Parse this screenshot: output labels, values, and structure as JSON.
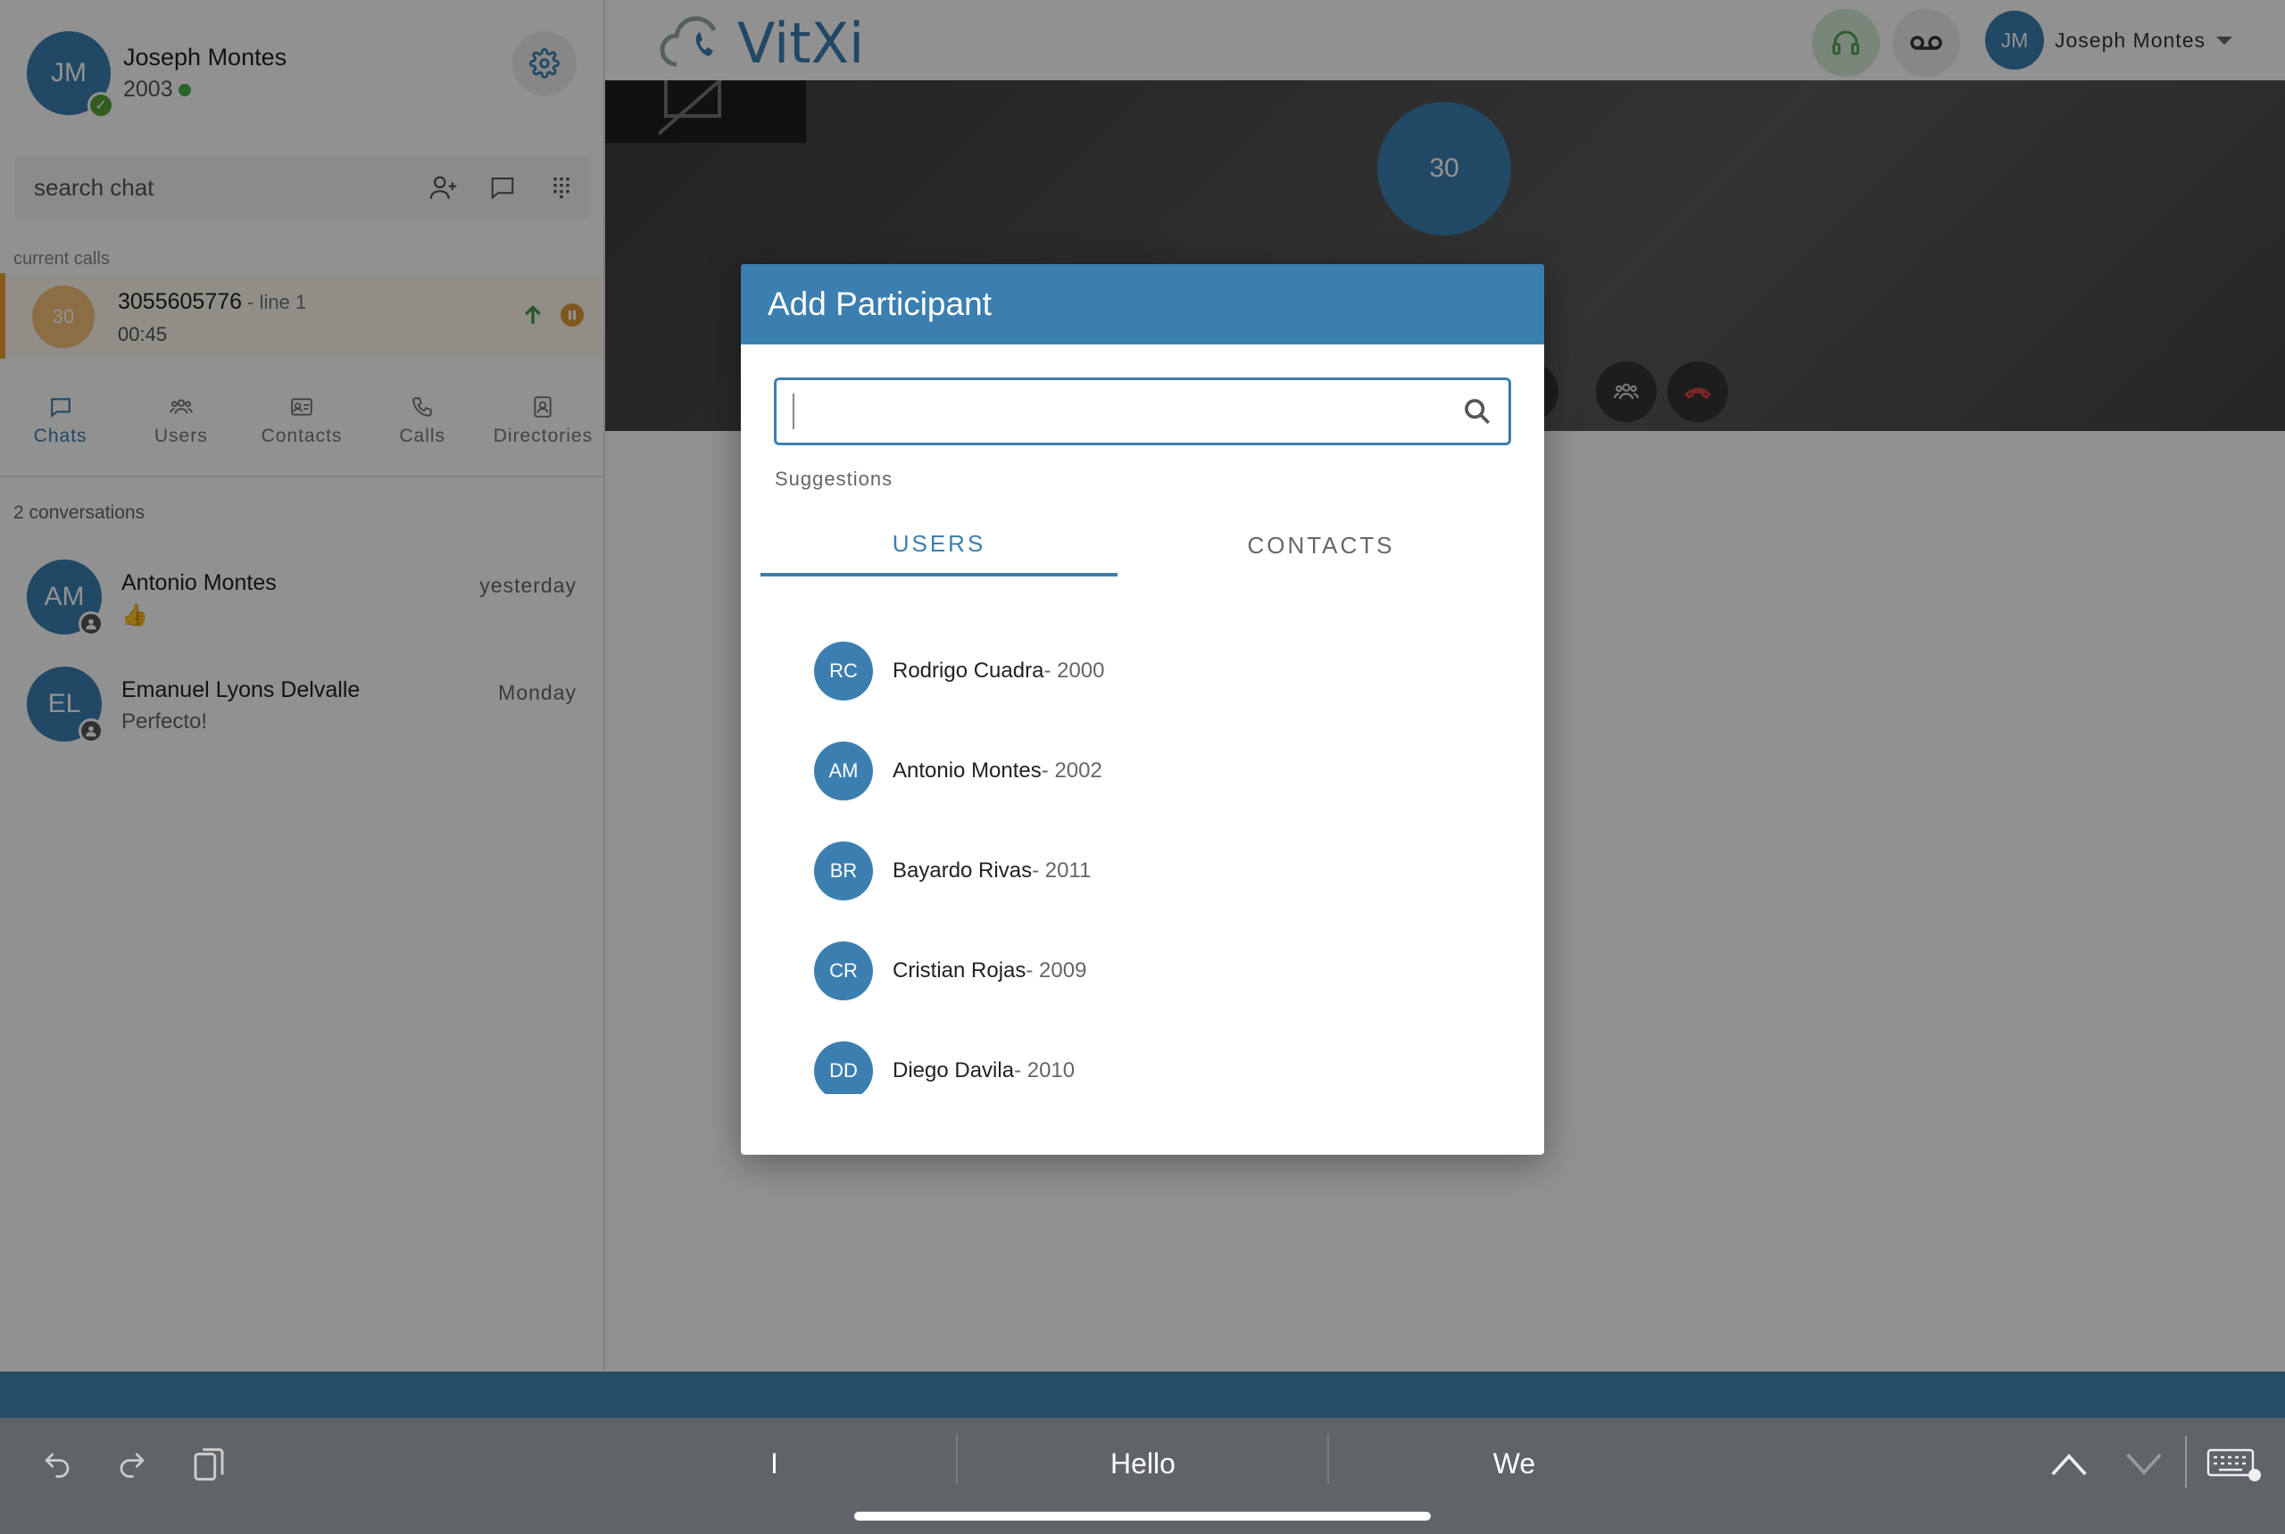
{
  "sidebar": {
    "profile": {
      "initials": "JM",
      "name": "Joseph Montes",
      "extension": "2003"
    },
    "search_placeholder": "search chat",
    "current_calls_label": "current calls",
    "current_call": {
      "avatar_text": "30",
      "number": "3055605776",
      "line": " - line 1",
      "timer": "00:45"
    },
    "nav": [
      "Chats",
      "Users",
      "Contacts",
      "Calls",
      "Directories"
    ],
    "conversations_count": "2 conversations",
    "conversations": [
      {
        "initials": "AM",
        "name": "Antonio Montes",
        "message": "👍",
        "time": "yesterday"
      },
      {
        "initials": "EL",
        "name": "Emanuel Lyons Delvalle",
        "message": "Perfecto!",
        "time": "Monday"
      }
    ]
  },
  "topbar": {
    "logo_text": "VitXi",
    "user_initials": "JM",
    "user_name": "Joseph Montes"
  },
  "video": {
    "remote_avatar_text": "30"
  },
  "modal": {
    "title": "Add Participant",
    "search_value": "",
    "suggestions_label": "Suggestions",
    "tabs": [
      "USERS",
      "CONTACTS"
    ],
    "users": [
      {
        "initials": "RC",
        "name": "Rodrigo Cuadra",
        "ext": " - 2000"
      },
      {
        "initials": "AM",
        "name": "Antonio Montes",
        "ext": " - 2002"
      },
      {
        "initials": "BR",
        "name": "Bayardo Rivas",
        "ext": " - 2011"
      },
      {
        "initials": "CR",
        "name": "Cristian Rojas",
        "ext": " - 2009"
      },
      {
        "initials": "DD",
        "name": "Diego Davila",
        "ext": " - 2010"
      }
    ]
  },
  "keyboard": {
    "predictions": [
      "I",
      "Hello",
      "We"
    ]
  },
  "colors": {
    "accent": "#3b7fb0",
    "call": "#f0a030",
    "online": "#4caf50"
  }
}
